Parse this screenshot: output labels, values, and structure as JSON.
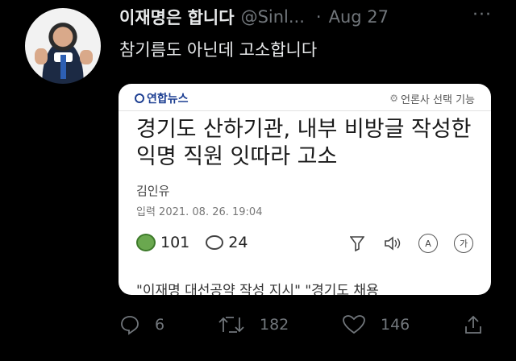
{
  "tweet": {
    "author_name": "이재명은 합니다",
    "handle": "@Sinl...",
    "separator": "·",
    "date": "Aug 27",
    "more_icon": "···",
    "text": "참기름도 아닌데 고소합니다"
  },
  "card": {
    "brand": "연합뉴스",
    "brand_option": "언론사 선택 기능",
    "headline": "경기도 산하기관, 내부 비방글 작성한 익명 직원 잇따라 고소",
    "author": "김인유",
    "date_label": "입력 2021. 08. 26. 19:04",
    "reactions": "101",
    "comments": "24",
    "tools": [
      "filter-icon",
      "speaker-icon",
      "translate-icon",
      "font-size-icon"
    ],
    "translate_label": "A",
    "font_label": "가",
    "snippet": "\"이재명 대선공약 작성 지시\" \"경기도 채용"
  },
  "actions": {
    "replies": "6",
    "retweets": "182",
    "likes": "146"
  },
  "colors": {
    "background": "#000000",
    "muted": "#71767b",
    "text": "#e7e9ea",
    "brand": "#1d3f92"
  }
}
